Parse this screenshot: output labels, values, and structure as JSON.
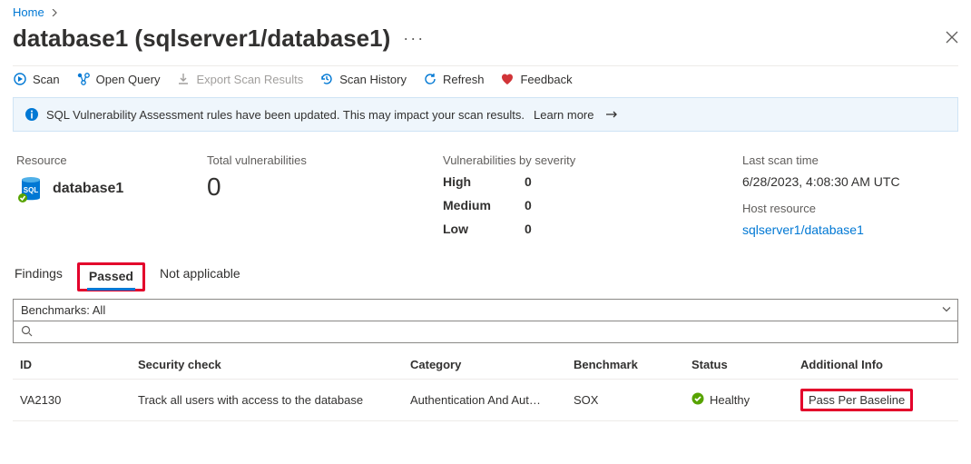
{
  "breadcrumb": {
    "home": "Home"
  },
  "title": "database1 (sqlserver1/database1)",
  "toolbar": {
    "scan": "Scan",
    "open_query": "Open Query",
    "export": "Export Scan Results",
    "history": "Scan History",
    "refresh": "Refresh",
    "feedback": "Feedback"
  },
  "banner": {
    "text": "SQL Vulnerability Assessment rules have been updated. This may impact your scan results.",
    "learn_more": "Learn more"
  },
  "overview": {
    "resource_label": "Resource",
    "resource_name": "database1",
    "total_label": "Total vulnerabilities",
    "total_value": "0",
    "severity_label": "Vulnerabilities by severity",
    "sev": {
      "high_label": "High",
      "high_val": "0",
      "med_label": "Medium",
      "med_val": "0",
      "low_label": "Low",
      "low_val": "0"
    },
    "last_scan_label": "Last scan time",
    "last_scan_value": "6/28/2023, 4:08:30 AM UTC",
    "host_label": "Host resource",
    "host_value": "sqlserver1/database1"
  },
  "tabs": {
    "findings": "Findings",
    "passed": "Passed",
    "na": "Not applicable"
  },
  "filters": {
    "benchmark": "Benchmarks: All",
    "search_placeholder": ""
  },
  "table": {
    "headers": {
      "id": "ID",
      "check": "Security check",
      "category": "Category",
      "benchmark": "Benchmark",
      "status": "Status",
      "info": "Additional Info"
    },
    "rows": [
      {
        "id": "VA2130",
        "check": "Track all users with access to the database",
        "category": "Authentication And Aut…",
        "benchmark": "SOX",
        "status": "Healthy",
        "info": "Pass Per Baseline"
      }
    ]
  }
}
